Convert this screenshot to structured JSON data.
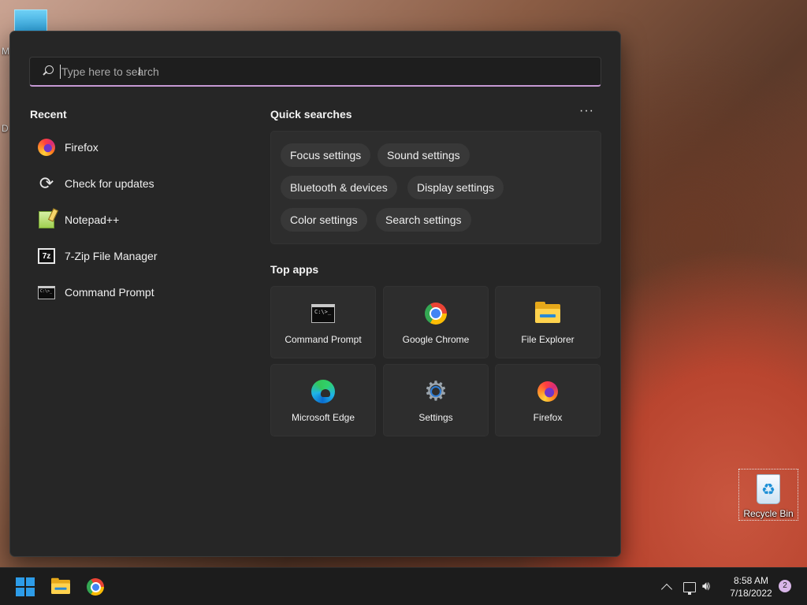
{
  "desktop": {
    "letters": [
      "M",
      "D"
    ],
    "recycle_bin_label": "Recycle Bin"
  },
  "search": {
    "placeholder": "Type here to search",
    "value": ""
  },
  "recent": {
    "title": "Recent",
    "items": [
      {
        "label": "Firefox",
        "icon": "firefox-icon"
      },
      {
        "label": "Check for updates",
        "icon": "sync-icon"
      },
      {
        "label": "Notepad++",
        "icon": "notepadpp-icon"
      },
      {
        "label": "7-Zip File Manager",
        "icon": "7zip-icon"
      },
      {
        "label": "Command Prompt",
        "icon": "command-prompt-icon"
      }
    ]
  },
  "quick_searches": {
    "title": "Quick searches",
    "more_label": "···",
    "chips": [
      "Focus settings",
      "Sound settings",
      "Bluetooth & devices",
      "Display settings",
      "Color settings",
      "Search settings"
    ]
  },
  "top_apps": {
    "title": "Top apps",
    "items": [
      {
        "label": "Command Prompt",
        "icon": "command-prompt-icon"
      },
      {
        "label": "Google Chrome",
        "icon": "chrome-icon"
      },
      {
        "label": "File Explorer",
        "icon": "folder-icon"
      },
      {
        "label": "Microsoft Edge",
        "icon": "edge-icon"
      },
      {
        "label": "Settings",
        "icon": "gear-icon"
      },
      {
        "label": "Firefox",
        "icon": "firefox-icon"
      }
    ]
  },
  "cmd_glyph": "C:\\>_",
  "taskbar": {
    "pinned": [
      "windows-start-icon",
      "file-explorer-icon",
      "chrome-icon"
    ],
    "clock_time": "8:58 AM",
    "clock_date": "7/18/2022",
    "notification_count": "2"
  },
  "colors": {
    "panel_bg": "#262626",
    "accent_underline": "#c699d4",
    "windows_blue": "#2d9ce8",
    "notification_badge": "#d8b6e8"
  }
}
